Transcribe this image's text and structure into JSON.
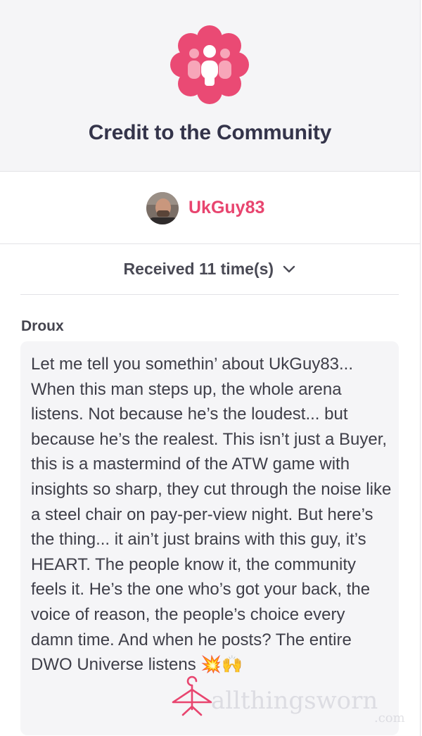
{
  "header": {
    "title": "Credit to the Community",
    "badge_icon": "community-people-icon",
    "badge_color": "#ea4a74"
  },
  "recipient": {
    "username": "UkGuy83",
    "username_color": "#e8456f",
    "avatar_icon": "user-avatar"
  },
  "summary": {
    "received_label": "Received 11 time(s)",
    "toggle_icon": "chevron-down-icon"
  },
  "credit": {
    "author": "Droux",
    "message": "Let me tell you somethin’ about UkGuy83... When this man steps up, the whole arena listens. Not because he’s the loudest... but because he’s the realest. This isn’t just a Buyer, this is a mastermind of the ATW game with insights so sharp, they cut through the noise like a steel chair on pay-per-view night. But here’s the thing... it ain’t just brains with this guy, it’s HEART. The people know it, the community feels it. He’s the one who’s got your back, the voice of reason, the people’s choice every damn time. And when he posts? The entire DWO Universe listens 💥🙌"
  },
  "watermark": {
    "text": "allthingsworn",
    "domain": ".com",
    "icon": "hanger-logo-icon"
  }
}
